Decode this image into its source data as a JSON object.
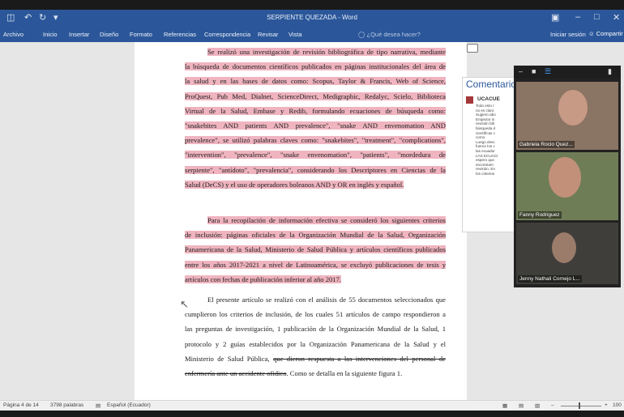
{
  "titlebar": {
    "title": "SERPIENTE QUEZADA - Word",
    "quick_access": [
      "save-icon",
      "undo-icon",
      "redo-icon",
      "customize-icon"
    ]
  },
  "ribbon": {
    "tabs": [
      "Archivo",
      "Inicio",
      "Insertar",
      "Diseño",
      "Formato",
      "Referencias",
      "Correspondencia",
      "Revisar",
      "Vista"
    ],
    "tell_me": "¿Qué desea hacer?",
    "sign_in": "Iniciar sesión",
    "share": "Compartir"
  },
  "document": {
    "para1": [
      "Se realizó una investigación de revisión bibliográfica de tipo narrativa, mediante",
      "la búsqueda de documentos científicos publicados en páginas institucionales del área de",
      "la salud y en las bases de datos como: Scopus, Taylor & Francis, Web of Science,",
      "ProQuest, Pub Med, Dialnet, ScienceDirect, Medigraphic, Redalyc, Scielo, Biblioteca",
      "Virtual de la Salud, Embase y Redib, formulando ecuaciones de búsqueda como:",
      "\"snakebites AND patients AND prevalence\", \"snake AND envenomation AND",
      "prevalence\", se utilizó palabras claves como: \"snakebites\", \"treatment\", \"complications\",",
      "\"intervention\", \"prevalence\", \"snake envenomation\", \"patients\", \"mordedura de",
      "serpiente\", \"antídoto\", \"prevalencia\", considerando los Descriptores en Ciencias de la",
      "Salud (DeCS) y el uso de operadores boleanos AND y OR en inglés y español."
    ],
    "para2": [
      "Para la recopilación de información efectiva se consideró los siguientes criterios",
      "de inclusión: páginas oficiales de la Organización Mundial de la Salud, Organización",
      "Panamericana de la Salud, Ministerio de Salud Pública y artículos científicos publicados",
      "entre los años 2017-2021 a nivel de Latinoamérica, se excluyó publicaciones de tesis y",
      "artículos con fechas de publicación inferior al año 2017."
    ],
    "para3": [
      "El presente artículo se realizó con el análisis de 55 documentos seleccionados que",
      "cumplieron los criterios de inclusión, de los cuales 51 artículos de campo respondieron a",
      "las preguntas de investigación, 1 publicación de la Organización Mundial de la Salud, 1",
      "protocolo y 2 guías establecidos por la Organización Panamericana de la Salud y el"
    ],
    "para3_line5_normal": "Ministerio de Salud Pública,",
    "para3_line5_struck": "que dieron respuesta a las intervenciones del personal de",
    "para3_line6_struck": "enfermería ante un accidente ofidico",
    "para3_line6_normal": ". Como se detalla en la siguiente figura 1."
  },
  "comments": {
    "heading": "Comentarios",
    "author": "UCACUE",
    "lines": [
      "Todo esto r",
      "no es claro",
      "Sugiero abo",
      "Empezar in",
      "revisión bib",
      "búsqueda d",
      "científicas c",
      "como",
      "Luego desc",
      "fueron los c",
      "las ecuador",
      "LAS ECUACI",
      "espero que",
      "encontrarn",
      "revisión. En",
      "los criterios"
    ]
  },
  "video_call": {
    "participants": [
      {
        "name": "Gabriela Rocio Quez..."
      },
      {
        "name": "Fanny Rodriguez"
      },
      {
        "name": "Jenny Nathali Cornejo L..."
      }
    ]
  },
  "statusbar": {
    "page": "Página 4 de 14",
    "words": "3798 palabras",
    "language": "Español (Ecuador)",
    "zoom": "100"
  },
  "colors": {
    "brand": "#2b579a",
    "highlight": "#efb4bf",
    "comment_accent": "#a4373a"
  }
}
